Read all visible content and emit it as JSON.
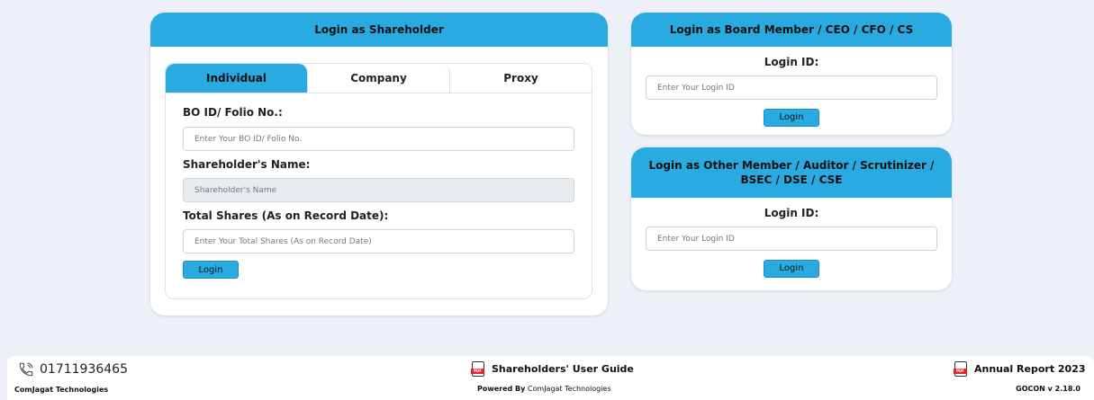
{
  "shareholder": {
    "title": "Login as Shareholder",
    "tabs": [
      {
        "label": "Individual"
      },
      {
        "label": "Company"
      },
      {
        "label": "Proxy"
      }
    ],
    "bo_label": "BO ID/ Folio No.:",
    "bo_placeholder": "Enter Your BO ID/ Folio No.",
    "name_label": "Shareholder's Name:",
    "name_placeholder": "Shareholder's Name",
    "shares_label": "Total Shares (As on Record Date):",
    "shares_placeholder": "Enter Your Total Shares (As on Record Date)",
    "login_label": "Login"
  },
  "board": {
    "title": "Login as Board Member / CEO / CFO / CS",
    "id_label": "Login ID:",
    "id_placeholder": "Enter Your Login ID",
    "login_label": "Login"
  },
  "other": {
    "title": "Login as Other Member / Auditor / Scrutinizer / BSEC / DSE / CSE",
    "id_label": "Login ID:",
    "id_placeholder": "Enter Your Login ID",
    "login_label": "Login"
  },
  "footer": {
    "phone": "01711936465",
    "company": "ComJagat Technologies",
    "guide_label": "Shareholders' User Guide",
    "powered_prefix": "Powered By",
    "powered_company": "ComJagat Technologies",
    "annual_report": "Annual Report 2023",
    "version": "GOCON v 2.18.0"
  },
  "colors": {
    "accent": "#29abe2",
    "background": "#eef0f7",
    "pdf_red": "#e0262a"
  },
  "icons": {
    "phone": "phone-icon",
    "pdf": "pdf-icon"
  }
}
